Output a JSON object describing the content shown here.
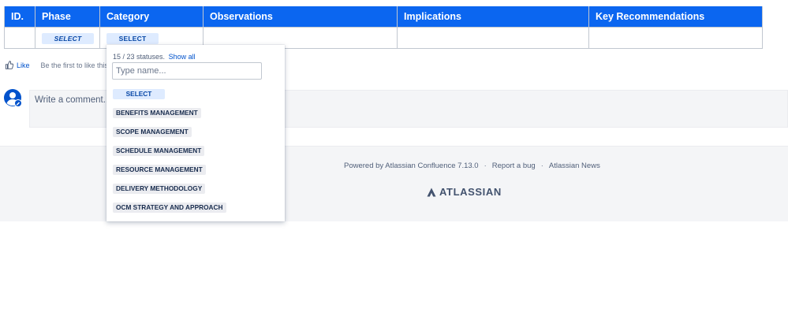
{
  "table": {
    "headers": [
      "ID.",
      "Phase",
      "Category",
      "Observations",
      "Implications",
      "Key Recommendations"
    ],
    "row": {
      "id": "",
      "phase": "SELECT",
      "category": "SELECT",
      "observations": "",
      "implications": "",
      "key_recommendations": ""
    }
  },
  "like": {
    "label": "Like",
    "prompt": "Be the first to like this"
  },
  "comment": {
    "placeholder": "Write a comment..."
  },
  "dropdown": {
    "count": "15 / 23 statuses.",
    "show_all": "Show all",
    "input_placeholder": "Type name...",
    "items": [
      "SELECT",
      "BENEFITS MANAGEMENT",
      "SCOPE MANAGEMENT",
      "SCHEDULE MANAGEMENT",
      "RESOURCE MANAGEMENT",
      "DELIVERY METHODOLOGY",
      "OCM STRATEGY AND APPROACH"
    ]
  },
  "footer": {
    "powered_by": "Powered by Atlassian Confluence 7.13.0",
    "report_bug": "Report a bug",
    "news": "Atlassian News",
    "logo_text": "ATLASSIAN"
  },
  "colors": {
    "header_blue": "#0b66f0",
    "link_blue": "#0052cc",
    "footer_bg": "#f4f5f7"
  }
}
